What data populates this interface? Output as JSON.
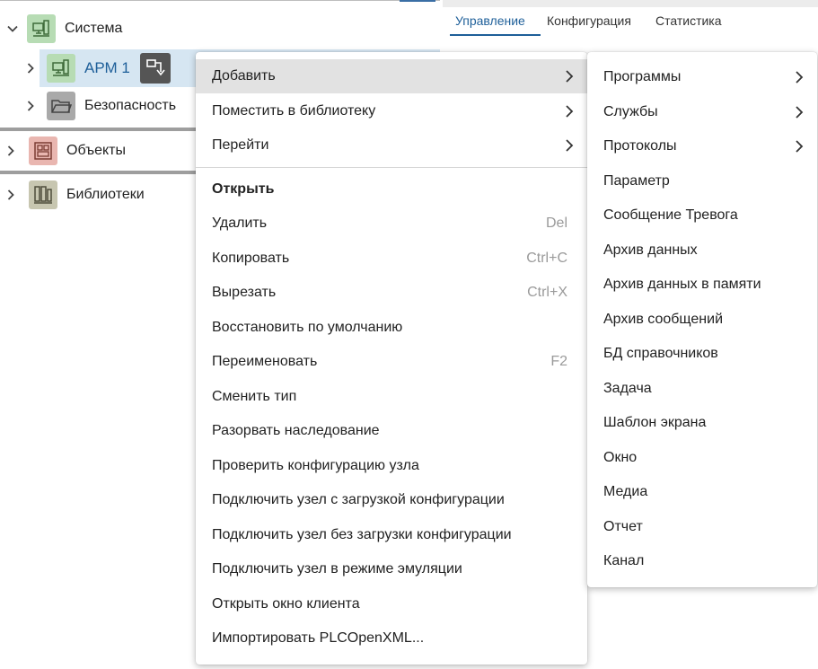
{
  "tree": {
    "items": [
      {
        "label": "Система",
        "icon": "system-icon"
      },
      {
        "label": "АРМ 1",
        "icon": "workstation-icon",
        "color": "#1e5f99"
      },
      {
        "label": "Безопасность",
        "icon": "folder-icon"
      },
      {
        "label": "Объекты",
        "icon": "objects-icon"
      },
      {
        "label": "Библиотеки",
        "icon": "library-icon"
      }
    ]
  },
  "tabs": [
    "Управление",
    "Конфигурация",
    "Статистика"
  ],
  "context_menu": {
    "items": [
      {
        "label": "Добавить",
        "submenu": true
      },
      {
        "label": "Поместить в библиотеку",
        "submenu": true
      },
      {
        "label": "Перейти",
        "submenu": true
      },
      {
        "label": "Открыть"
      },
      {
        "label": "Удалить",
        "shortcut": "Del"
      },
      {
        "label": "Копировать",
        "shortcut": "Ctrl+C"
      },
      {
        "label": "Вырезать",
        "shortcut": "Ctrl+X"
      },
      {
        "label": "Восстановить по умолчанию"
      },
      {
        "label": "Переименовать",
        "shortcut": "F2"
      },
      {
        "label": "Сменить тип"
      },
      {
        "label": "Разорвать наследование"
      },
      {
        "label": "Проверить конфигурацию узла"
      },
      {
        "label": "Подключить узел с загрузкой конфигурации"
      },
      {
        "label": "Подключить узел без загрузки конфигурации"
      },
      {
        "label": "Подключить узел в режиме эмуляции"
      },
      {
        "label": "Открыть окно клиента"
      },
      {
        "label": "Импортировать PLCOpenXML..."
      }
    ]
  },
  "submenu": {
    "items": [
      {
        "label": "Программы",
        "submenu": true
      },
      {
        "label": "Службы",
        "submenu": true
      },
      {
        "label": "Протоколы",
        "submenu": true
      },
      {
        "label": "Параметр"
      },
      {
        "label": "Сообщение Тревога"
      },
      {
        "label": "Архив данных"
      },
      {
        "label": "Архив данных в памяти"
      },
      {
        "label": "Архив сообщений"
      },
      {
        "label": "БД справочников"
      },
      {
        "label": "Задача"
      },
      {
        "label": "Шаблон экрана"
      },
      {
        "label": "Окно"
      },
      {
        "label": "Медиа"
      },
      {
        "label": "Отчет"
      },
      {
        "label": "Канал"
      }
    ]
  },
  "colors": {
    "accent": "#1e5f99",
    "selected_row": "#d6e6f2",
    "menu_highlight": "#e2e2e2",
    "system_icon_bg": "#b7dcb4",
    "workstation_icon_bg": "#b7dcb4",
    "folder_icon_bg": "#a9a9a9",
    "objects_icon_bg": "#e9b6b0",
    "library_icon_bg": "#c7c6b0"
  }
}
